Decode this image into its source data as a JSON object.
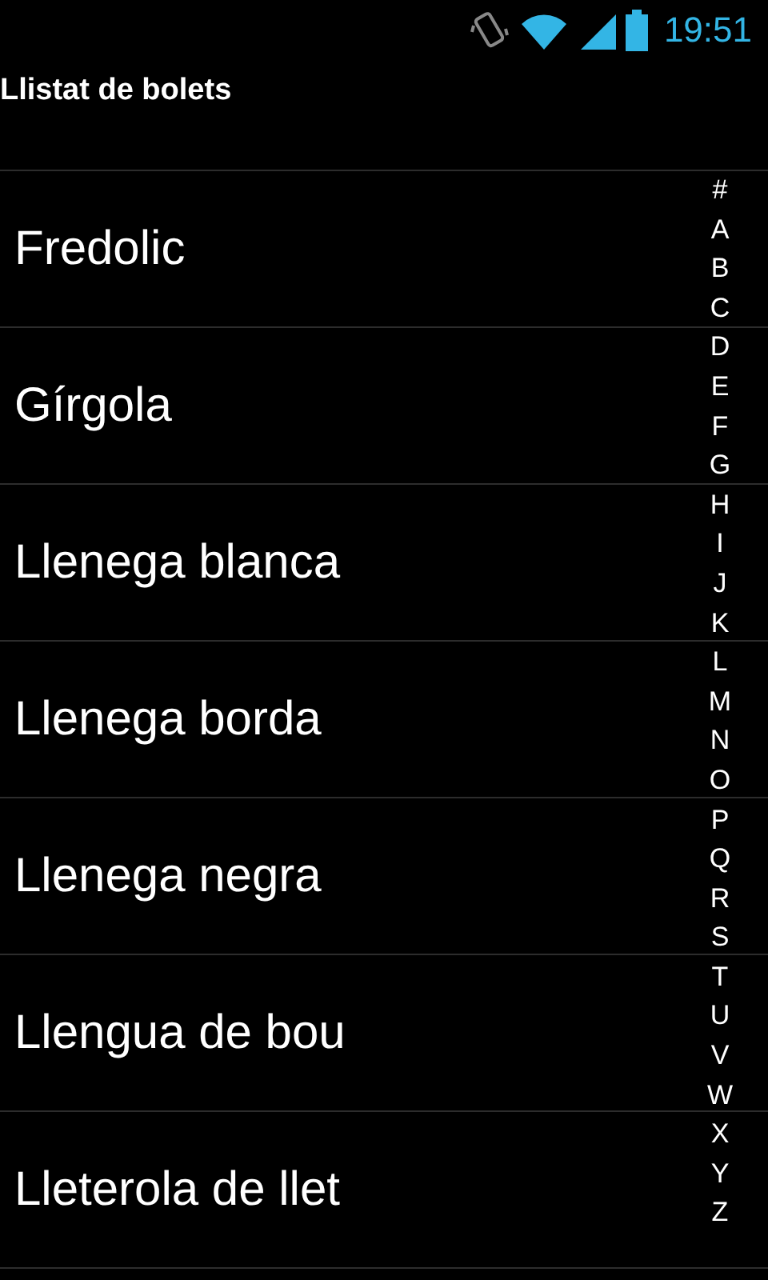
{
  "status_bar": {
    "time": "19:51"
  },
  "title": "Llistat de bolets",
  "items": [
    "Fredolic",
    "Gírgola",
    "Llenega blanca",
    "Llenega borda",
    "Llenega negra",
    "Llengua de bou",
    "Lleterola de llet"
  ],
  "index": [
    "#",
    "A",
    "B",
    "C",
    "D",
    "E",
    "F",
    "G",
    "H",
    "I",
    "J",
    "K",
    "L",
    "M",
    "N",
    "O",
    "P",
    "Q",
    "R",
    "S",
    "T",
    "U",
    "V",
    "W",
    "X",
    "Y",
    "Z"
  ]
}
